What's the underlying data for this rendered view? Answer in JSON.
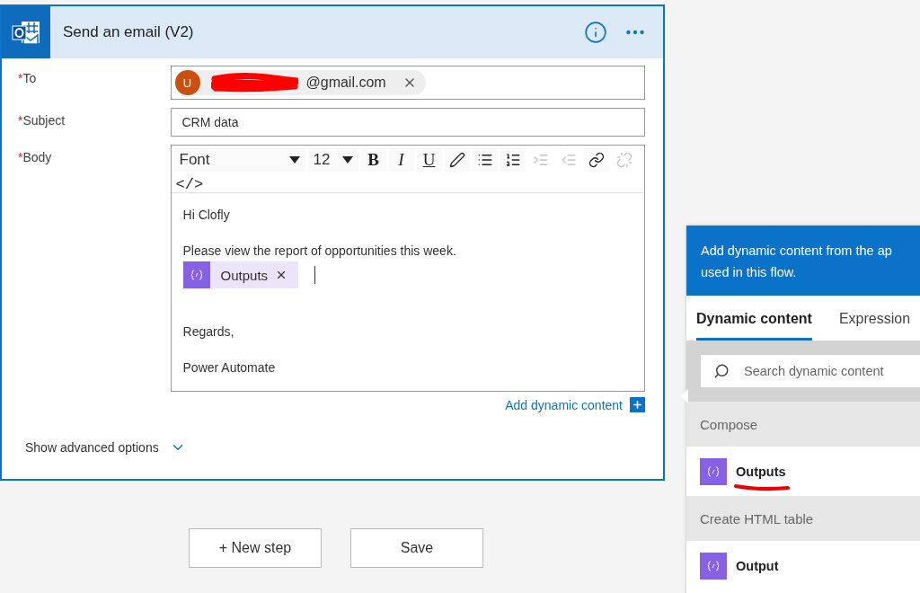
{
  "card": {
    "title": "Send an email (V2)",
    "fields": [
      {
        "kind": "recipient",
        "label": "To",
        "required_mark": "*",
        "avatar": "U",
        "value": "@gmail.com",
        "redacted": true
      },
      {
        "kind": "text",
        "label": "Subject",
        "required_mark": "*",
        "value": "CRM data"
      },
      {
        "kind": "editor",
        "label": "Body",
        "required_mark": "*"
      }
    ],
    "editor": {
      "font": "Font",
      "size": "12",
      "code_view": "</>",
      "tools": [
        {
          "kind": "bold",
          "label": "B",
          "disabled": false
        },
        {
          "kind": "italic",
          "label": "I",
          "disabled": false
        },
        {
          "kind": "underline",
          "label": "U",
          "disabled": false
        },
        {
          "kind": "color",
          "disabled": false
        },
        {
          "kind": "bullets",
          "disabled": false
        },
        {
          "kind": "numbers",
          "disabled": false
        },
        {
          "kind": "indent",
          "disabled": true
        },
        {
          "kind": "outdent",
          "disabled": true
        },
        {
          "kind": "link",
          "disabled": false
        },
        {
          "kind": "unlink",
          "disabled": true
        }
      ],
      "content": [
        {
          "kind": "text",
          "text": "Hi Clofly"
        },
        {
          "kind": "text",
          "text": "Please view the report of opportunities this week."
        },
        {
          "kind": "token",
          "text": "Outputs"
        },
        {
          "kind": "gap"
        },
        {
          "kind": "text",
          "text": "Regards,"
        },
        {
          "kind": "text",
          "text": "Power Automate"
        }
      ]
    },
    "add_dynamic": "Add dynamic content",
    "advanced": "Show advanced options"
  },
  "actions": [
    "+ New step",
    "Save"
  ],
  "panel": {
    "header": "Add dynamic content from the ap\nused in this flow.",
    "tabs": [
      {
        "label": "Dynamic content",
        "selected": true
      },
      {
        "label": "Expression",
        "selected": false
      }
    ],
    "search": {
      "placeholder": "Search dynamic content"
    },
    "groups": [
      {
        "title": "Compose",
        "items": [
          {
            "label": "Outputs",
            "underlined": true
          }
        ]
      },
      {
        "title": "Create HTML table",
        "items": [
          {
            "label": "Output",
            "underlined": false
          }
        ]
      }
    ]
  }
}
